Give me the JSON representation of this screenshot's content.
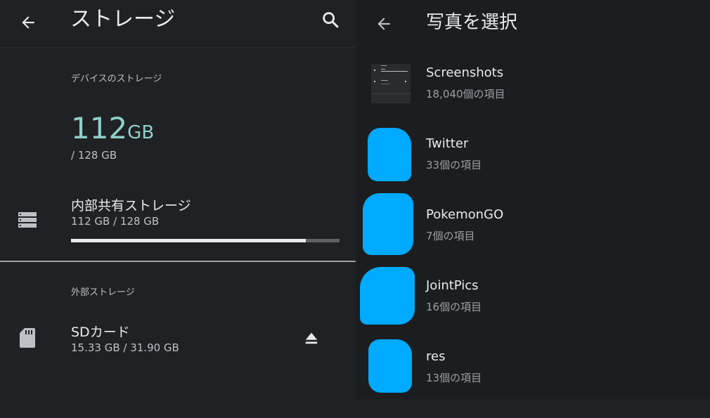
{
  "storage": {
    "title": "ストレージ",
    "device_section": "デバイスのストレージ",
    "used_value": "112",
    "used_unit": "GB",
    "total_label": "/ 128 GB",
    "internal": {
      "title": "内部共有ストレージ",
      "usage": "112 GB / 128 GB",
      "used_fraction": 0.875
    },
    "external_section": "外部ストレージ",
    "sd": {
      "title": "SDカード",
      "usage": "15.33 GB / 31.90 GB"
    }
  },
  "picker": {
    "title": "写真を選択",
    "albums": [
      {
        "name": "Screenshots",
        "count": "18,040個の項目"
      },
      {
        "name": "Twitter",
        "count": "33個の項目"
      },
      {
        "name": "PokemonGO",
        "count": "7個の項目"
      },
      {
        "name": "JointPics",
        "count": "16個の項目"
      },
      {
        "name": "res",
        "count": "13個の項目"
      }
    ]
  },
  "colors": {
    "accent": "#8fd1c9",
    "redaction": "#00aaff",
    "background": "#202124"
  },
  "icons": [
    "back-arrow-icon",
    "search-icon",
    "storage-stack-icon",
    "sd-card-icon",
    "eject-icon"
  ]
}
